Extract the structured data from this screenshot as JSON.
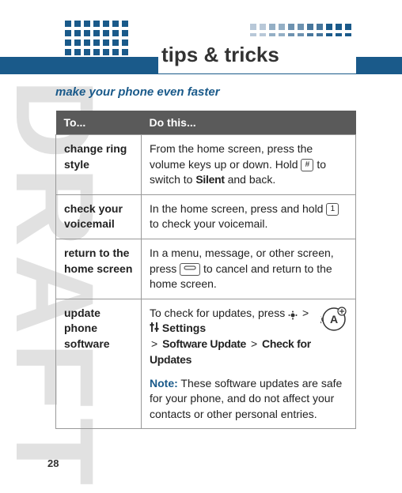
{
  "header": {
    "title": "tips & tricks",
    "subtitle": "make your phone even faster"
  },
  "watermark": "DRAFT",
  "page_number": "28",
  "table": {
    "header_to": "To...",
    "header_do": "Do this...",
    "rows": [
      {
        "to": "change ring style",
        "do_pre": "From the home screen, press the volume keys up or down. Hold ",
        "key": "#",
        "do_mid": " to switch to ",
        "silent": "Silent",
        "do_post": " and back."
      },
      {
        "to": "check your voicemail",
        "do_pre": "In the home screen, press and hold ",
        "key": "1",
        "do_post": " to check your voicemail."
      },
      {
        "to": "return to the home screen",
        "do_pre": "In a menu, message, or other screen, press ",
        "key": "⏏",
        "do_post": " to cancel and return to the home screen."
      },
      {
        "to": "update phone software",
        "line1_pre": "To check for updates, press ",
        "sep": ">",
        "settings_label": "Settings",
        "sw_update": "Software Update",
        "check_updates": "Check for Updates",
        "note_label": "Note:",
        "note_text": " These software updates are safe for your phone, and do not affect your contacts or other personal entries."
      }
    ]
  }
}
